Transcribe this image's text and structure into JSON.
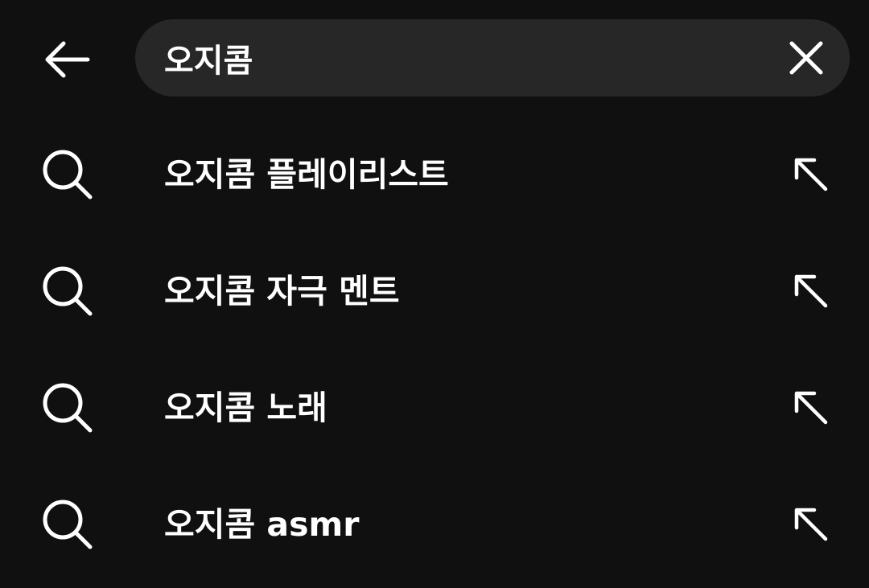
{
  "search": {
    "query": "오지콤"
  },
  "suggestions": [
    {
      "text": "오지콤 플레이리스트"
    },
    {
      "text": "오지콤 자극 멘트"
    },
    {
      "text": "오지콤 노래"
    },
    {
      "text": "오지콤 asmr"
    }
  ],
  "icons": {
    "back": "arrow-left-icon",
    "clear": "close-icon",
    "suggestion": "search-icon",
    "fill": "arrow-up-left-icon"
  },
  "colors": {
    "background": "#101010",
    "search_field": "#272727",
    "text": "#ffffff"
  }
}
